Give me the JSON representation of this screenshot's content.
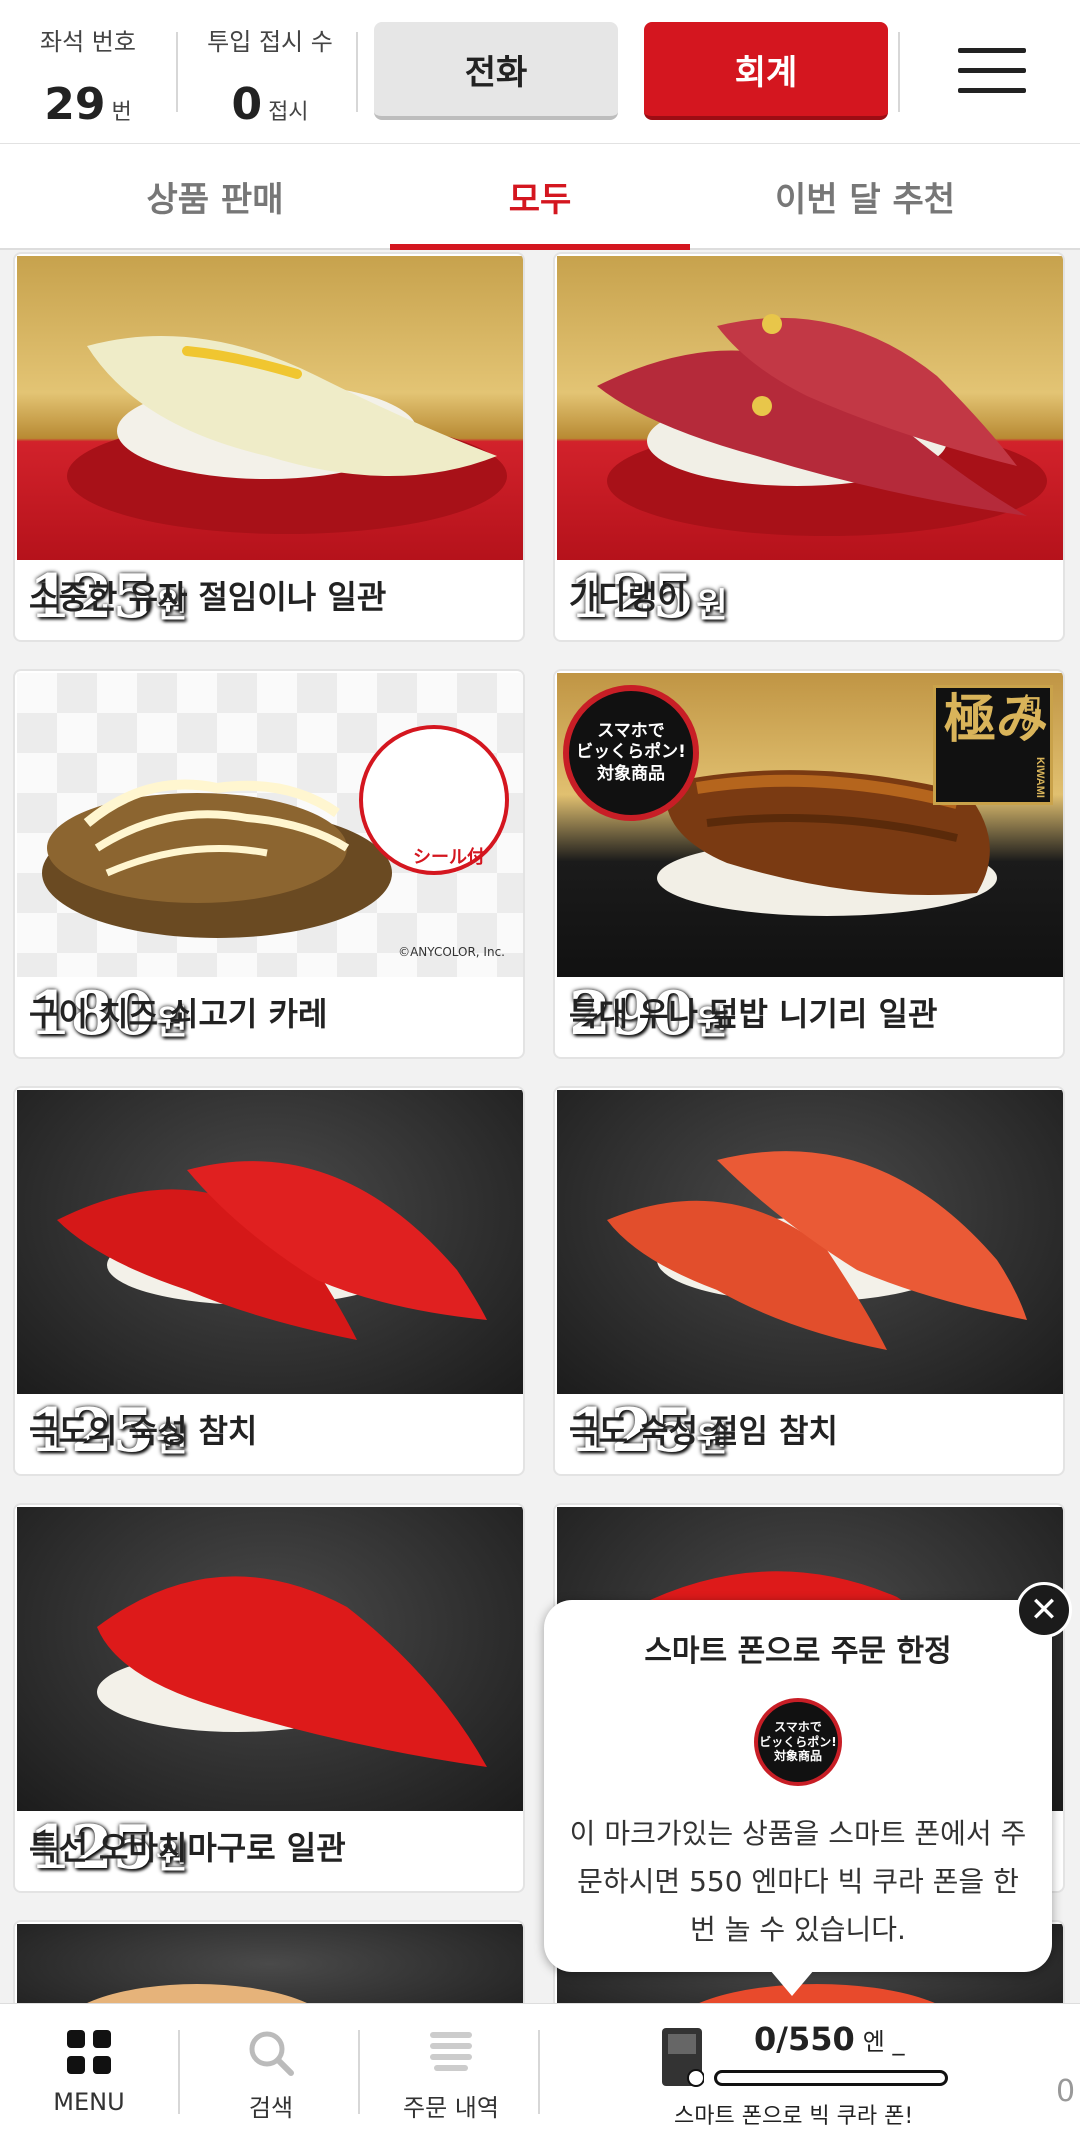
{
  "header": {
    "seat_label": "좌석 번호",
    "seat_value": "29",
    "seat_unit": "번",
    "plates_label": "투입 접시 수",
    "plates_value": "0",
    "plates_unit": "접시",
    "call_label": "전화",
    "bill_label": "회계",
    "menu_icon": "hamburger-menu-icon"
  },
  "tabs": [
    {
      "label": "상품 판매",
      "active": false
    },
    {
      "label": "모두",
      "active": true
    },
    {
      "label": "이번 달 추천",
      "active": false
    }
  ],
  "items": [
    {
      "name": "소중한 유자 절임이나 일관",
      "price": "125",
      "currency": "원"
    },
    {
      "name": "가다랭이",
      "price": "125",
      "currency": "원"
    },
    {
      "name": "구이 치즈 쇠고기 카레",
      "price": "180",
      "currency": "원"
    },
    {
      "name": "특대 우나 덮밥 니기리 일관",
      "price": "290",
      "currency": "원"
    },
    {
      "name": "극도의 숙성 참치",
      "price": "125",
      "currency": "원"
    },
    {
      "name": "극도 숙성 절임 참치",
      "price": "125",
      "currency": "원"
    },
    {
      "name": "특선 오바치마구로 일관",
      "price": "125",
      "currency": "원"
    }
  ],
  "image_text": {
    "sticker_label": "シール付",
    "copyright": "©ANYCOLOR, Inc.",
    "badge_line1": "スマホで",
    "badge_line2": "ビッくらポン!",
    "badge_line3": "対象商品",
    "kiwami_main": "極み",
    "kiwami_side": "旬の",
    "kiwami_en": "KIWAMI"
  },
  "popup": {
    "title": "스마트 폰으로 주문 한정",
    "text": "이 마크가있는 상품을 스마트 폰에서 주문하시면 550 엔마다 빅 쿠라 폰을 한 번 놀 수 있습니다.",
    "close_icon": "close-icon"
  },
  "bottom_nav": {
    "menu_label": "MENU",
    "search_label": "검색",
    "history_label": "주문 내역",
    "coupon_count": "0/550",
    "coupon_unit": "엔 _",
    "coupon_label": "스마트 폰으로 빅 쿠라 폰!",
    "coupon_progress": 0,
    "side_number": "0"
  },
  "colors": {
    "accent": "#d4161f",
    "text": "#222222",
    "tab_inactive": "#777777"
  }
}
